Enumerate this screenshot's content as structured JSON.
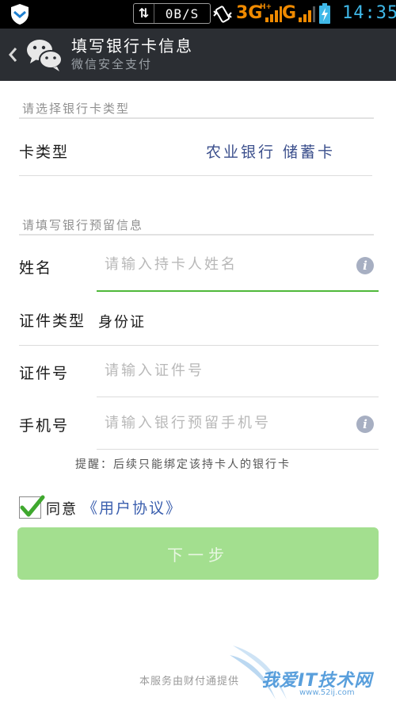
{
  "status_bar": {
    "traffic_speed": "0B/S",
    "network_3g": "3G",
    "network_3g_suffix": "H+",
    "network_g": "G",
    "time": "14:35"
  },
  "nav_bar": {
    "title": "填写银行卡信息",
    "subtitle": "微信安全支付"
  },
  "card_section": {
    "prompt": "请选择银行卡类型",
    "card_type_label": "卡类型",
    "card_type_value": "农业银行 储蓄卡"
  },
  "info_section": {
    "prompt": "请填写银行预留信息",
    "name_label": "姓名",
    "name_placeholder": "请输入持卡人姓名",
    "id_type_label": "证件类型",
    "id_type_value": "身份证",
    "id_number_label": "证件号",
    "id_number_placeholder": "请输入证件号",
    "phone_label": "手机号",
    "phone_placeholder": "请输入银行预留手机号",
    "info_icon_glyph": "i",
    "hint": "提醒：后续只能绑定该持卡人的银行卡"
  },
  "agreement": {
    "agree_text": "同意",
    "link_text": "《用户协议》",
    "checked": true
  },
  "next_button_label": "下一步",
  "footer_text": "本服务由财付通提供",
  "watermark": {
    "text": "我爱IT技术网",
    "url": "www.52ij.com"
  },
  "colors": {
    "nav_background": "#2b2e33",
    "focus_line": "#4fb83a",
    "button_background": "#a3df8f",
    "link": "#3b5fae",
    "network_indicator": "#f08a00",
    "clock": "#3fb8e8"
  }
}
